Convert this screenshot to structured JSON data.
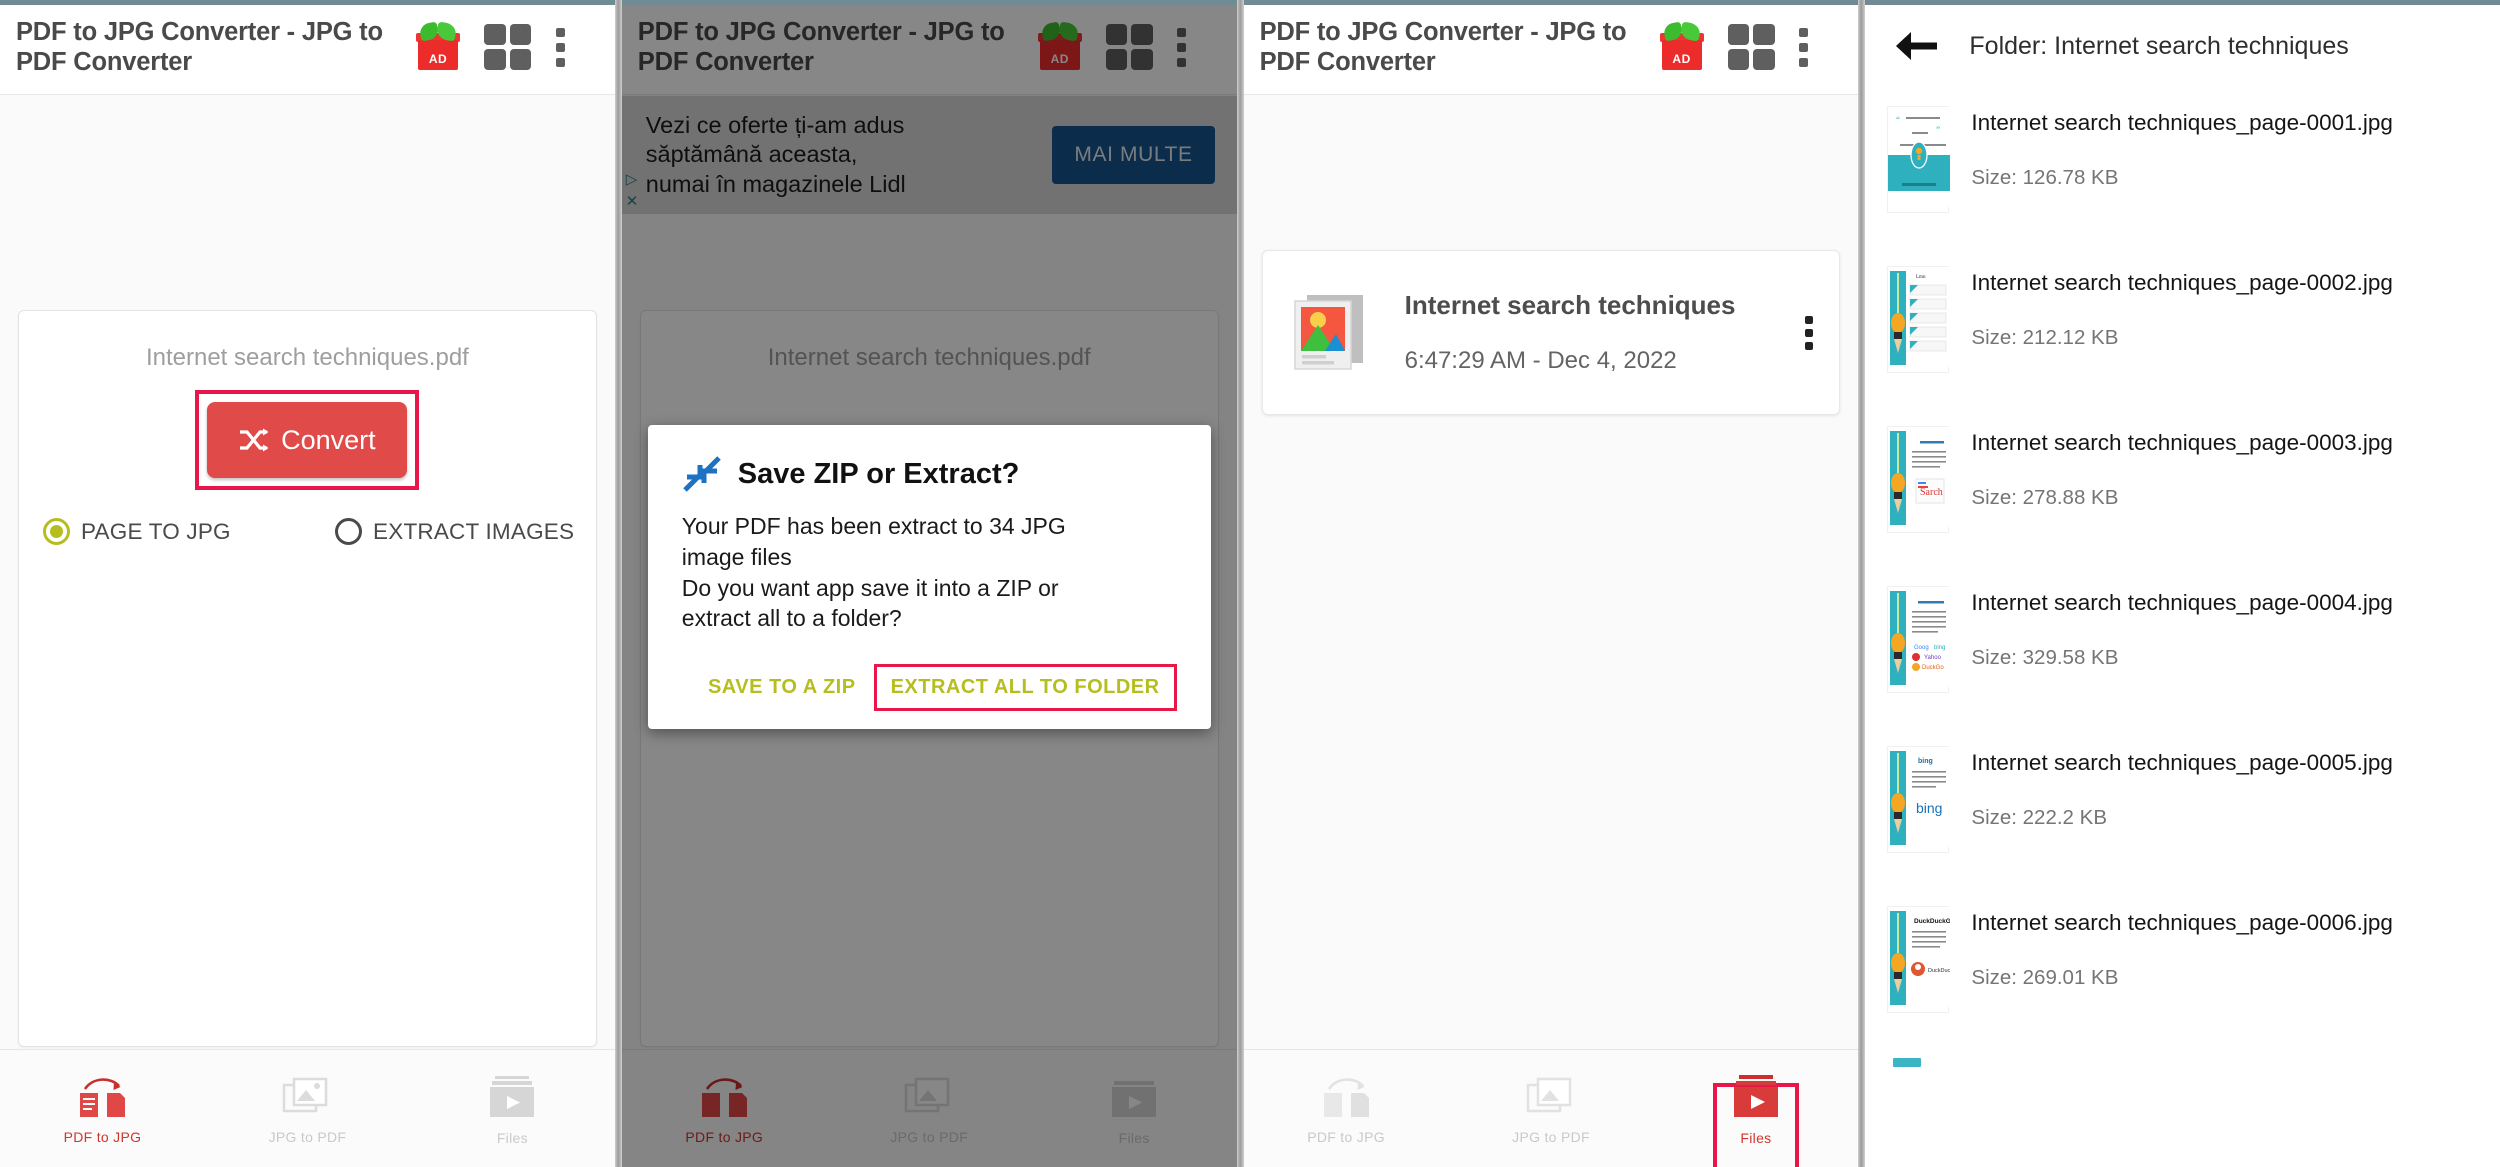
{
  "app": {
    "title": "PDF to JPG Converter - JPG to PDF Converter",
    "ad_badge_label": "AD"
  },
  "panel1": {
    "file_name": "Internet search techniques.pdf",
    "convert_label": "Convert",
    "options": [
      {
        "label": "PAGE TO JPG",
        "selected": true
      },
      {
        "label": "EXTRACT IMAGES",
        "selected": false
      }
    ],
    "highlight_color": "#e8174a",
    "convert_button_color": "#e04a49",
    "radio_color": "#b6be1f"
  },
  "panel2": {
    "ad": {
      "line1": "Vezi ce oferte ți-am adus",
      "line2": "săptămână aceasta,",
      "line3": "numai în magazinele Lidl",
      "cta": "MAI MULTE",
      "cta_color": "#16538c"
    },
    "dialog": {
      "title": "Save ZIP or Extract?",
      "body_line1": "Your PDF has been extract to 34 JPG",
      "body_line2": "image files",
      "body_line3": "Do you want app save it into a ZIP or",
      "body_line4": "extract all to a folder?",
      "btn_save_zip": "SAVE TO A ZIP",
      "btn_extract_folder": "EXTRACT ALL TO FOLDER",
      "btn_color": "#b6be1f",
      "highlight_color": "#e8174a"
    }
  },
  "panel3": {
    "file_card": {
      "title": "Internet search techniques",
      "timestamp": "6:47:29 AM - Dec 4, 2022"
    }
  },
  "panel4": {
    "header_title": "Folder: Internet search techniques",
    "files": [
      {
        "name": "Internet search techniques_page-0001.jpg",
        "size": "Size: 126.78 KB"
      },
      {
        "name": "Internet search techniques_page-0002.jpg",
        "size": "Size: 212.12 KB"
      },
      {
        "name": "Internet search techniques_page-0003.jpg",
        "size": "Size: 278.88 KB"
      },
      {
        "name": "Internet search techniques_page-0004.jpg",
        "size": "Size: 329.58 KB"
      },
      {
        "name": "Internet search techniques_page-0005.jpg",
        "size": "Size: 222.2 KB"
      },
      {
        "name": "Internet search techniques_page-0006.jpg",
        "size": "Size: 269.01 KB"
      }
    ]
  },
  "bottom_nav": {
    "items": [
      {
        "label": "PDF to JPG"
      },
      {
        "label": "JPG to PDF"
      },
      {
        "label": "Files"
      }
    ],
    "active_color": "#d0342c",
    "inactive_color": "#c9c9c9"
  }
}
